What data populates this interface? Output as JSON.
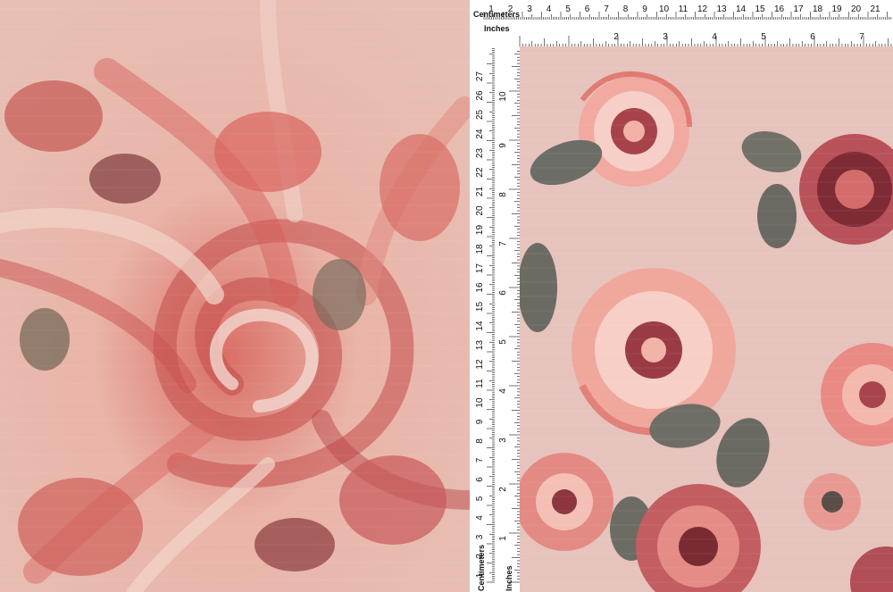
{
  "ruler": {
    "centimeters_label": "Centimeters",
    "inches_label": "Inches",
    "top_cm_numbers": [
      "1",
      "2",
      "3",
      "4",
      "5",
      "6",
      "7",
      "8",
      "9",
      "10",
      "11",
      "12",
      "13",
      "14",
      "15",
      "16",
      "17",
      "18",
      "19",
      "20",
      "21"
    ],
    "top_in_numbers": [
      "1",
      "2",
      "3",
      "4",
      "5",
      "6",
      "7",
      "8"
    ],
    "left_cm_numbers": [
      "1",
      "2",
      "3",
      "4",
      "5",
      "6",
      "7",
      "8",
      "9",
      "10",
      "11",
      "12",
      "13",
      "14",
      "15",
      "16",
      "17",
      "18",
      "19",
      "20",
      "21",
      "22",
      "23",
      "24",
      "25",
      "26",
      "27"
    ],
    "left_in_numbers": [
      "1",
      "2",
      "3",
      "4",
      "5",
      "6",
      "7",
      "8",
      "9",
      "10"
    ]
  },
  "colors": {
    "fabric_base": "#e7c3bd",
    "rose_coral": "#e3766f",
    "rose_deep": "#8c2f36",
    "leaf_gray": "#6f6e66",
    "swirl_base": "#e9c2b7"
  }
}
